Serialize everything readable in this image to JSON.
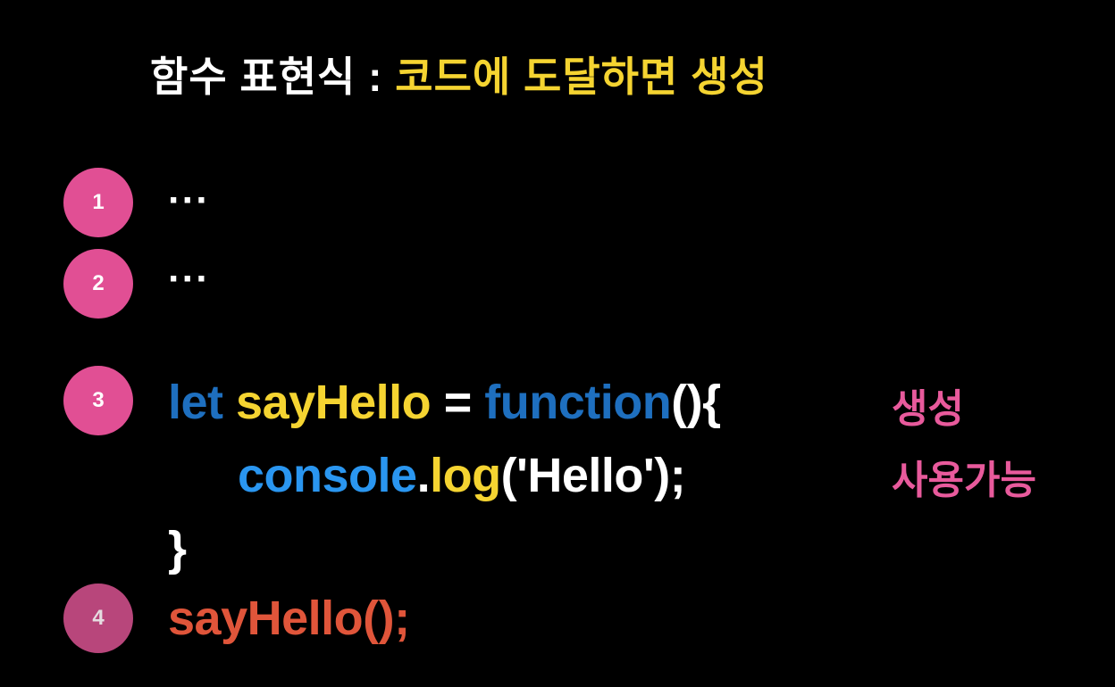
{
  "title": {
    "prefix": "함수 표현식 : ",
    "highlight": "코드에 도달하면 생성"
  },
  "steps": [
    {
      "number": "1",
      "text": "···"
    },
    {
      "number": "2",
      "text": "···"
    },
    {
      "number": "3"
    },
    {
      "number": "4"
    }
  ],
  "code": {
    "line1": {
      "kw_let": "let",
      "name": "sayHello",
      "eq": "=",
      "kw_function": "function",
      "paren_open": "(){"
    },
    "line2": {
      "obj": "console",
      "dot": ".",
      "method": "log",
      "paren_l": "(",
      "string": "'Hello'",
      "paren_r": ");"
    },
    "line3": {
      "brace": "}"
    },
    "line4": {
      "call": "sayHello();"
    }
  },
  "notes": {
    "created": "생성",
    "usable": "사용가능"
  },
  "colors": {
    "background": "#000000",
    "badge": "#e14f94",
    "title_highlight": "#f5d431",
    "keyword": "#1e6fbf",
    "identifier": "#f5d431",
    "console": "#2a96f0",
    "call": "#e0553a",
    "note": "#e85a9c"
  }
}
